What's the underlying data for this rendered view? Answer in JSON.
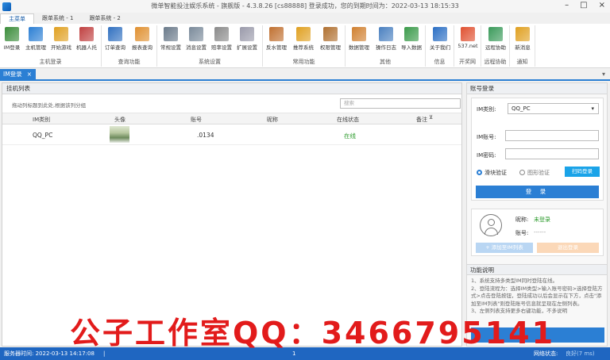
{
  "window": {
    "title": "微单智能投注娱乐系统 - 旗舰版 - 4.3.8.26    [cs88888] 登录成功，您的到期时间为：2022-03-13 18:15:33",
    "controls": [
      "–",
      "□",
      "×"
    ]
  },
  "ribbon_tabs": [
    "主菜单",
    "跟单系统 - 1",
    "跟单系统 - 2"
  ],
  "ribbon_groups": [
    {
      "label": "主机登录"
    },
    {
      "label": "查询功能"
    },
    {
      "label": "系统设置"
    },
    {
      "label": "常用功能"
    },
    {
      "label": "其他"
    },
    {
      "label": "信息"
    },
    {
      "label": "开奖网"
    },
    {
      "label": "远程协助"
    },
    {
      "label": "通知"
    }
  ],
  "ribbon_buttons": [
    {
      "label": "IM登录",
      "icon": "im-login-icon",
      "color": "#3a8c3a"
    },
    {
      "label": "主机管理",
      "icon": "host-manage-icon",
      "color": "#2b7fd4"
    },
    {
      "label": "开始游戏",
      "icon": "start-game-icon",
      "color": "#e0a020"
    },
    {
      "label": "机器人托",
      "icon": "robot-icon",
      "color": "#c04040"
    },
    {
      "label": "订单查询",
      "icon": "order-query-icon",
      "color": "#3070c0"
    },
    {
      "label": "报表查询",
      "icon": "report-query-icon",
      "color": "#e09030"
    },
    {
      "label": "常规设置",
      "icon": "gear-icon",
      "color": "#6a7a8a"
    },
    {
      "label": "消息设置",
      "icon": "message-settings-icon",
      "color": "#7a8a9a"
    },
    {
      "label": "赔率设置",
      "icon": "odds-settings-icon",
      "color": "#8a8a8a"
    },
    {
      "label": "扩展设置",
      "icon": "extend-settings-icon",
      "color": "#9a9aaa"
    },
    {
      "label": "反水管理",
      "icon": "rebate-icon",
      "color": "#c07030"
    },
    {
      "label": "推荐系统",
      "icon": "recommend-icon",
      "color": "#e0a020"
    },
    {
      "label": "权限管理",
      "icon": "permission-icon",
      "color": "#b07030"
    },
    {
      "label": "数据管理",
      "icon": "data-manage-icon",
      "color": "#d08030"
    },
    {
      "label": "操作日志",
      "icon": "log-icon",
      "color": "#4a80c0"
    },
    {
      "label": "导入数据",
      "icon": "import-icon",
      "color": "#3a9a4a"
    },
    {
      "label": "关于我们",
      "icon": "info-icon",
      "color": "#2b6fc4"
    },
    {
      "label": "537.net",
      "icon": "bar-chart-icon",
      "color": "#e05030"
    },
    {
      "label": "远程协助",
      "icon": "remote-assist-icon",
      "color": "#3a9a5a"
    },
    {
      "label": "新消息",
      "icon": "bell-icon",
      "color": "#e0a020"
    }
  ],
  "doc_tab": {
    "label": "IM登录",
    "close": "×"
  },
  "left_panel": {
    "title": "挂机列表",
    "group_hint": "拖动列标题到此处,根据该列分组",
    "search_placeholder": "搜索",
    "columns": [
      "IM类别",
      "头像",
      "账号",
      "昵称",
      "在线状态",
      "备注"
    ],
    "filter_glyph": "⊻",
    "rows": [
      {
        "im_type": "QQ_PC",
        "account": ".0134",
        "status": "在线"
      }
    ]
  },
  "right_panel": {
    "title": "账号登录",
    "im_type_label": "IM类别:",
    "im_type_value": "QQ_PC",
    "account_label": "IM账号:",
    "password_label": "IM密码:",
    "slider_verify": "滑块验证",
    "image_verify": "图形验证",
    "scan_login": "扫码登录",
    "login": "登 录",
    "nickname_label": "昵称:",
    "nickname_value": "未登录",
    "account_label2": "账号:",
    "account_value2": "------",
    "add_to_list": "+ 添加至IM列表",
    "logout": "退出登录",
    "func_title": "功能说明",
    "func_lines": [
      "1、系统支持多类型IM同时登陆在线。",
      "2、登陆流程为：选择IM类型>输入账号密码>选择登陆方式>点击登陆按钮，登陆成功以后会显示在下方，点击\"添加至IM列表\"则登陆账号信息就呈现在左侧列表。",
      "3、左侧列表支持更多右键功能，不多说明"
    ]
  },
  "watermark": "公子工作室QQ：3466795141",
  "statusbar": {
    "server_time": "服务器时间: 2022-03-13 14:17:08",
    "sep": "|",
    "center": "1",
    "net_status_label": "网络状态:",
    "net_status_value": "良好(7 ms)"
  }
}
